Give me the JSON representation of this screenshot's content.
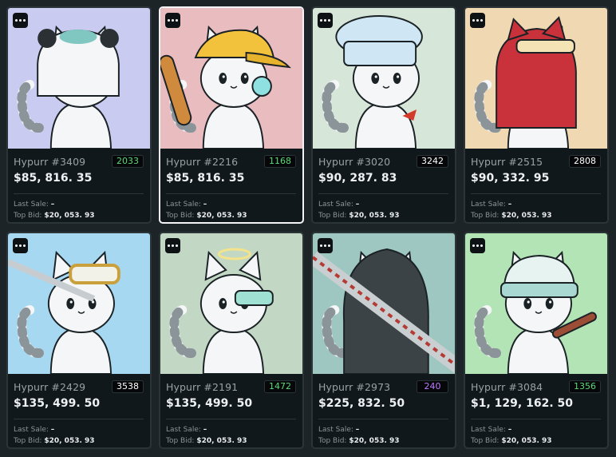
{
  "more_icon": "ellipsis-icon",
  "labels": {
    "last_sale": "Last Sale:",
    "top_bid": "Top Bid:"
  },
  "cards": [
    {
      "name": "Hypurr #3409",
      "rank": "2033",
      "rank_color": "#5dd97a",
      "price": "$85, 816. 35",
      "last_sale": "–",
      "top_bid": "$20, 053. 93",
      "bg": "#c9ccf0",
      "accessory": "panda-hood"
    },
    {
      "name": "Hypurr #2216",
      "rank": "1168",
      "rank_color": "#5dd97a",
      "price": "$85, 816. 35",
      "last_sale": "–",
      "top_bid": "$20, 053. 93",
      "bg": "#e9bcc0",
      "accessory": "yellow-cap"
    },
    {
      "name": "Hypurr #3020",
      "rank": "3242",
      "rank_color": "#ffffff",
      "price": "$90, 287. 83",
      "last_sale": "–",
      "top_bid": "$20, 053. 93",
      "bg": "#d6e7d9",
      "accessory": "chef-hat"
    },
    {
      "name": "Hypurr #2515",
      "rank": "2808",
      "rank_color": "#ffffff",
      "price": "$90, 332. 95",
      "last_sale": "–",
      "top_bid": "$20, 053. 93",
      "bg": "#f0d9b2",
      "accessory": "red-hood"
    },
    {
      "name": "Hypurr #2429",
      "rank": "3538",
      "rank_color": "#ffffff",
      "price": "$135, 499. 50",
      "last_sale": "–",
      "top_bid": "$20, 053. 93",
      "bg": "#a6d8f2",
      "accessory": "goggles"
    },
    {
      "name": "Hypurr #2191",
      "rank": "1472",
      "rank_color": "#5dd97a",
      "price": "$135, 499. 50",
      "last_sale": "–",
      "top_bid": "$20, 053. 93",
      "bg": "#c3d8c4",
      "accessory": "halo"
    },
    {
      "name": "Hypurr #2973",
      "rank": "240",
      "rank_color": "#c07bff",
      "price": "$225, 832. 50",
      "last_sale": "–",
      "top_bid": "$20, 053. 93",
      "bg": "#9ec7c1",
      "accessory": "dark-hood"
    },
    {
      "name": "Hypurr #3084",
      "rank": "1356",
      "rank_color": "#5dd97a",
      "price": "$1, 129, 162. 50",
      "last_sale": "–",
      "top_bid": "$20, 053. 93",
      "bg": "#b3e4b6",
      "accessory": "beanie"
    }
  ]
}
